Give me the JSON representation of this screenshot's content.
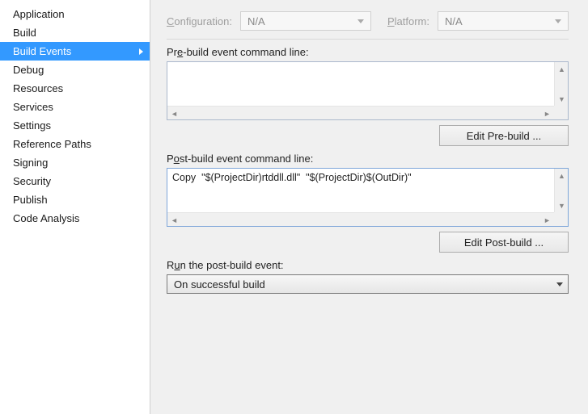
{
  "sidebar": {
    "items": [
      {
        "label": "Application"
      },
      {
        "label": "Build"
      },
      {
        "label": "Build Events"
      },
      {
        "label": "Debug"
      },
      {
        "label": "Resources"
      },
      {
        "label": "Services"
      },
      {
        "label": "Settings"
      },
      {
        "label": "Reference Paths"
      },
      {
        "label": "Signing"
      },
      {
        "label": "Security"
      },
      {
        "label": "Publish"
      },
      {
        "label": "Code Analysis"
      }
    ],
    "active_index": 2
  },
  "top": {
    "configuration_label": "onfiguration:",
    "configuration_prefix": "C",
    "configuration_value": "N/A",
    "platform_label": "latform:",
    "platform_prefix": "P",
    "platform_value": "N/A"
  },
  "prebuild": {
    "label_prefix": "Pr",
    "label_u": "e",
    "label_suffix": "-build event command line:",
    "value": "",
    "button": "Edit Pre-build ..."
  },
  "postbuild": {
    "label_prefix": "P",
    "label_u": "o",
    "label_suffix": "st-build event command line:",
    "value": "Copy  \"$(ProjectDir)rtddll.dll\"  \"$(ProjectDir)$(OutDir)\"",
    "button": "Edit Post-build ..."
  },
  "run": {
    "label_prefix": "R",
    "label_u": "u",
    "label_suffix": "n the post-build event:",
    "value": "On successful build"
  }
}
